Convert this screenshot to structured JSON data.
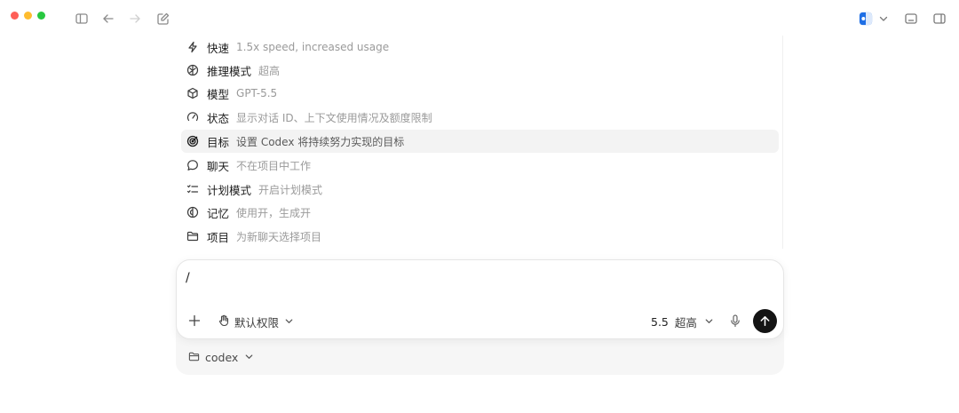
{
  "window": {
    "controls": [
      "close",
      "minimize",
      "maximize"
    ],
    "toolbar_icons": [
      "sidebar-toggle-icon",
      "back-arrow-icon",
      "forward-arrow-icon",
      "compose-icon"
    ],
    "right_icons": [
      "app-icon",
      "chevron-down-icon",
      "terminal-icon",
      "panel-toggle-icon"
    ]
  },
  "slash_menu": {
    "items": [
      {
        "icon": "lightning-icon",
        "label": "快速",
        "desc": "1.5x speed, increased usage"
      },
      {
        "icon": "brain-icon",
        "label": "推理模式",
        "desc": "超高"
      },
      {
        "icon": "cube-icon",
        "label": "模型",
        "desc": "GPT-5.5"
      },
      {
        "icon": "gauge-icon",
        "label": "状态",
        "desc": "显示对话 ID、上下文使用情况及额度限制"
      },
      {
        "icon": "target-icon",
        "label": "目标",
        "desc": "设置 Codex 将持续努力实现的目标",
        "active": true
      },
      {
        "icon": "chat-bubble-icon",
        "label": "聊天",
        "desc": "不在项目中工作"
      },
      {
        "icon": "checklist-icon",
        "label": "计划模式",
        "desc": "开启计划模式"
      },
      {
        "icon": "memory-icon",
        "label": "记忆",
        "desc": "使用开，生成开"
      },
      {
        "icon": "folder-icon",
        "label": "项目",
        "desc": "为新聊天选择项目"
      }
    ]
  },
  "composer": {
    "input_value": "/",
    "permission_label": "默认权限",
    "model_version": "5.5",
    "reasoning_effort": "超高"
  },
  "project": {
    "name": "codex"
  },
  "colors": {
    "send_button": "#141414",
    "active_row": "#f3f3f3",
    "traffic_close": "#fe5f57",
    "traffic_min": "#febc2e",
    "traffic_max": "#28c840"
  }
}
